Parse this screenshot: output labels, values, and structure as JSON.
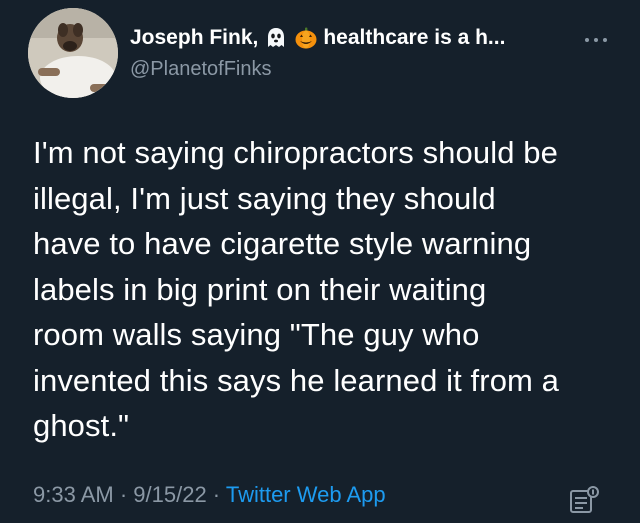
{
  "author": {
    "name": "Joseph Fink,",
    "emoji_1": "ghost-icon",
    "emoji_2": "pumpkin-icon",
    "name_suffix": "healthcare is a h...",
    "handle": "@PlanetofFinks"
  },
  "tweet": {
    "text": "I'm not saying chiropractors should be\nillegal, I'm just saying they should\nhave to have cigarette style warning\nlabels in big print on their waiting\nroom walls saying \"The guy who\ninvented this says he learned it from a\nghost.\"",
    "time": "9:33 AM",
    "separator": " · ",
    "date": "9/15/22",
    "source": "Twitter Web App"
  },
  "colors": {
    "background": "#15202b",
    "text_primary": "#ffffff",
    "text_secondary": "#8b98a5",
    "link": "#1d9bf0"
  }
}
